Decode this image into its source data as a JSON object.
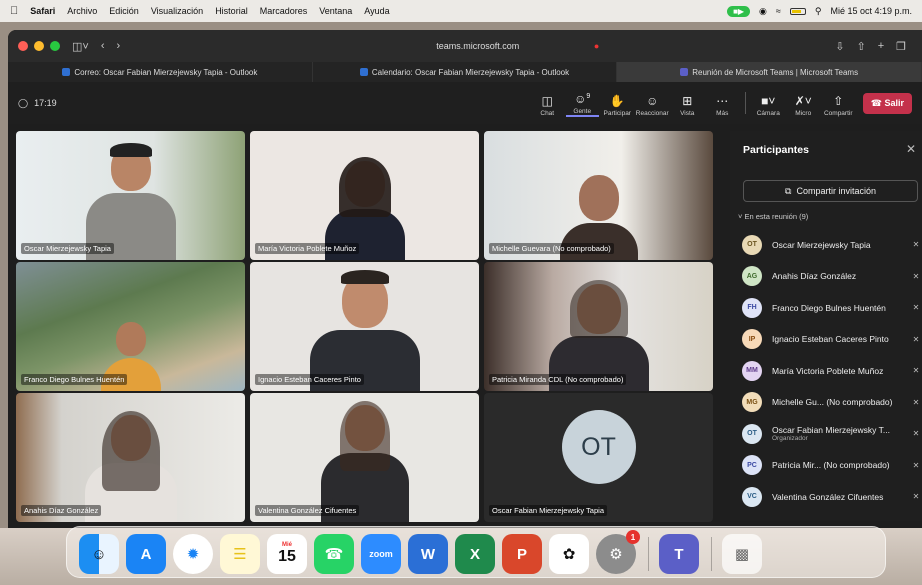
{
  "menubar": {
    "app": "Safari",
    "items": [
      "Archivo",
      "Edición",
      "Visualización",
      "Historial",
      "Marcadores",
      "Ventana",
      "Ayuda"
    ],
    "clock": "Mié 15 oct 4:19 p.m."
  },
  "browser": {
    "url": "teams.microsoft.com",
    "tabs": [
      {
        "label": "Correo: Oscar Fabian Mierzejewsky Tapia - Outlook",
        "color": "#2f6fd1"
      },
      {
        "label": "Calendario: Oscar Fabian Mierzejewsky Tapia - Outlook",
        "color": "#2f6fd1"
      },
      {
        "label": "Reunión de Microsoft Teams | Microsoft Teams",
        "color": "#5b5fc7"
      }
    ]
  },
  "meeting": {
    "timer": "17:19",
    "controls": [
      {
        "label": "Chat",
        "icon": "chat-icon"
      },
      {
        "label": "Gente",
        "icon": "people-icon",
        "count": "9"
      },
      {
        "label": "Participar",
        "icon": "raise-hand-icon"
      },
      {
        "label": "Reaccionar",
        "icon": "smile-icon"
      },
      {
        "label": "Vista",
        "icon": "grid-view-icon"
      },
      {
        "label": "Más",
        "icon": "more-icon"
      }
    ],
    "media": [
      {
        "label": "Cámara",
        "icon": "camera-icon"
      },
      {
        "label": "Micro",
        "icon": "mic-off-icon"
      },
      {
        "label": "Compartir",
        "icon": "share-icon"
      }
    ],
    "leave_label": "Salir"
  },
  "tiles": [
    {
      "name": "Oscar Mierzejewsky Tapia"
    },
    {
      "name": "María Victoria Poblete Muñoz"
    },
    {
      "name": "Michelle Guevara (No comprobado)"
    },
    {
      "name": "Franco Diego Bulnes Huentén"
    },
    {
      "name": "Ignacio Esteban Caceres Pinto"
    },
    {
      "name": "Patricia Miranda CDL (No comprobado)"
    },
    {
      "name": "Anahis Díaz González"
    },
    {
      "name": "Valentina González Cifuentes"
    },
    {
      "name": "Oscar Fabian Mierzejewsky Tapia",
      "initials": "OT"
    }
  ],
  "panel": {
    "title": "Participantes",
    "invite_label": "Compartir invitación",
    "section_label": "En esta reunión (9)",
    "participants": [
      {
        "initials": "OT",
        "name": "Oscar Mierzejewsky Tapia",
        "color": "#e8d9b5",
        "text_color": "#6b5520",
        "role": ""
      },
      {
        "initials": "AG",
        "name": "Anahis Díaz González",
        "color": "#cfe5c5",
        "text_color": "#3f6b2c",
        "role": ""
      },
      {
        "initials": "FH",
        "name": "Franco Diego Bulnes Huentén",
        "color": "#dfe3f7",
        "text_color": "#3c4aa3",
        "role": ""
      },
      {
        "initials": "IP",
        "name": "Ignacio Esteban Caceres Pinto",
        "color": "#f7d9b8",
        "text_color": "#8a4e12",
        "role": ""
      },
      {
        "initials": "MM",
        "name": "María Victoria Poblete Muñoz",
        "color": "#e3d4f2",
        "text_color": "#5e3a8a",
        "role": ""
      },
      {
        "initials": "MG",
        "name": "Michelle Gu... (No comprobado)",
        "color": "#f2ddb9",
        "text_color": "#7a5012",
        "role": ""
      },
      {
        "initials": "OT",
        "name": "Oscar Fabian Mierzejewsky T...",
        "color": "#dbe7f2",
        "text_color": "#2b5d85",
        "role": "Organizador"
      },
      {
        "initials": "PC",
        "name": "Patricia Mir... (No comprobado)",
        "color": "#dce3f7",
        "text_color": "#3c4aa3",
        "role": ""
      },
      {
        "initials": "VC",
        "name": "Valentina González Cifuentes",
        "color": "#dbe7f2",
        "text_color": "#2b5d85",
        "role": ""
      }
    ]
  },
  "dock": {
    "calendar_month": "Mié",
    "calendar_day": "15",
    "zoom_label": "zoom",
    "settings_badge": "1"
  }
}
